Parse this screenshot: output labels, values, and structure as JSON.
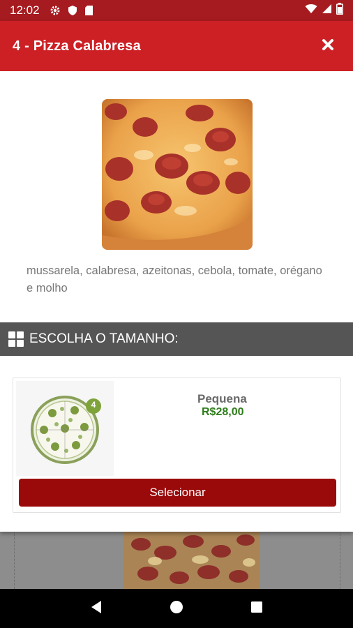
{
  "status_bar": {
    "time": "12:02",
    "icons": [
      "gear-icon",
      "shield-icon",
      "sd-card-icon",
      "wifi-icon",
      "signal-icon",
      "battery-icon"
    ]
  },
  "modal": {
    "title": "4 - Pizza Calabresa",
    "close_icon": "close-icon",
    "description": "mussarela, calabresa, azeitonas, cebola, tomate, orégano e molho",
    "section_title": "ESCOLHA O TAMANHO:",
    "sizes": [
      {
        "name": "Pequena",
        "price": "R$28,00",
        "slices_badge": "4",
        "select_label": "Selecionar"
      }
    ]
  },
  "colors": {
    "header_red": "#cc2025",
    "status_red": "#a61b1f",
    "button_red": "#9a0a0a",
    "price_green": "#2e7d1a",
    "section_gray": "#555555"
  },
  "nav_bar": {
    "icons": [
      "back-icon",
      "home-icon",
      "recents-icon"
    ]
  }
}
